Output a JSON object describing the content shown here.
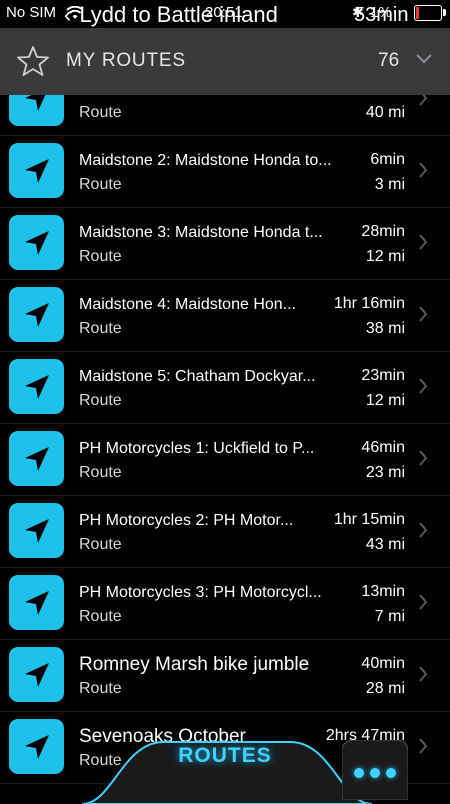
{
  "status_bar": {
    "carrier": "No SIM",
    "time": "20:51",
    "battery_pct": "1%",
    "colors": {
      "battery_low": "#e53935"
    }
  },
  "nav_overlay": {
    "title": "Lydd to Battle inland",
    "distance_time": "53min"
  },
  "header": {
    "title": "MY ROUTES",
    "count": "76",
    "icon_left": "star-icon",
    "icon_right": "chevron-down-icon"
  },
  "routes": [
    {
      "name": "",
      "type": "Route",
      "duration": "",
      "distance": "40 mi",
      "large": false
    },
    {
      "name": "Maidstone 2: Maidstone Honda to...",
      "type": "Route",
      "duration": "6min",
      "distance": "3 mi",
      "large": false
    },
    {
      "name": "Maidstone 3: Maidstone Honda t...",
      "type": "Route",
      "duration": "28min",
      "distance": "12 mi",
      "large": false
    },
    {
      "name": "Maidstone 4: Maidstone Hon...",
      "type": "Route",
      "duration": "1hr 16min",
      "distance": "38 mi",
      "large": false
    },
    {
      "name": "Maidstone 5: Chatham Dockyar...",
      "type": "Route",
      "duration": "23min",
      "distance": "12 mi",
      "large": false
    },
    {
      "name": "PH Motorcycles 1: Uckfield to P...",
      "type": "Route",
      "duration": "46min",
      "distance": "23 mi",
      "large": false
    },
    {
      "name": "PH Motorcycles 2: PH Motor...",
      "type": "Route",
      "duration": "1hr 15min",
      "distance": "43 mi",
      "large": false
    },
    {
      "name": "PH Motorcycles 3: PH Motorcycl...",
      "type": "Route",
      "duration": "13min",
      "distance": "7 mi",
      "large": false
    },
    {
      "name": "Romney Marsh bike jumble",
      "type": "Route",
      "duration": "40min",
      "distance": "28 mi",
      "large": true
    },
    {
      "name": "Sevenoaks October",
      "type": "Route",
      "duration": "2hrs 47min",
      "distance": "",
      "large": true
    }
  ],
  "bottom_bar": {
    "tab_label": "ROUTES",
    "more_icon": "more-dots-icon"
  },
  "colors": {
    "tile": "#1ec1ea",
    "header_bg": "#3a3a3c",
    "accent": "#3fd2ff"
  }
}
